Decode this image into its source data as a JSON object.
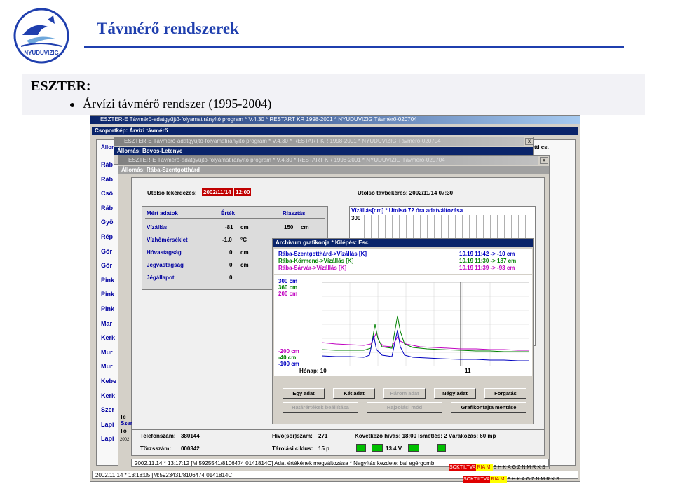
{
  "slide": {
    "title": "Távmérő rendszerek",
    "logo_text": "NYUDUVIZIG",
    "heading": "ESZTER:",
    "bullet": "Árvízi távmérő rendszer (1995-2004)"
  },
  "main_window": {
    "title": "ESZTER-E Távmérő-adatgyűjtő-folyamatirányító program * V.4.30 * RESTART KR 1998-2001 * NYUDUVIZIG Távmérő-020704",
    "group_bar": "Csoportkép: Árvízi távmérő",
    "side_header": "Állom",
    "side_header_right": "tti cs.",
    "sidebar_items": [
      "Ráb",
      "Ráb",
      "Csö",
      "Ráb",
      "Gyö",
      "Rép",
      "Gőr",
      "Gőr",
      "Pink",
      "Pink",
      "Pink",
      "Mar",
      "Kerk",
      "Mur",
      "Mur",
      "Kebe",
      "Kerk",
      "Szer",
      "Lapi",
      "Lapi"
    ],
    "status": "2002.11.14 * 13:18:05 [M:5923431/8106474 0141814C]",
    "flags": [
      "SOKTILTVA",
      "RIA MI",
      "E",
      "H",
      "K",
      "A",
      "G",
      "Z",
      "N",
      "M",
      "R",
      "X",
      "S"
    ]
  },
  "second_window": {
    "title": "ESZTER-E Távmérő-adatgyűjtő-folyamatirányító program * V.4.30 * RESTART KR 1998-2001 * NYUDUVIZIG Távmérő-020704",
    "station_bar": "Állomás: Bovos-Letenye",
    "close": "x"
  },
  "third_window": {
    "title": "ESZTER-E Távmérő-adatgyűjtő-folyamatirányító program * V.4.30 * RESTART KR 1998-2001 * NYUDUVIZIG Távmérő-020704",
    "station_bar": "Állomás: Rába-Szentgotthárd",
    "close": "x",
    "last_query_label": "Utolsó lekérdezés:",
    "last_query_date": "2002/11/14",
    "last_query_time": "12:00",
    "last_remote_label": "Utolsó távbekérés: 2002/11/14  07:30",
    "table_headers": [
      "Mért adatok",
      "Érték",
      "Riasztás"
    ],
    "rows": [
      {
        "name": "Vízállás",
        "value": "-81",
        "unit": "cm",
        "alarm": "150",
        "alarm_unit": "cm"
      },
      {
        "name": "Vízhőmérséklet",
        "value": "-1.0",
        "unit": "°C",
        "alarm": "",
        "alarm_unit": ""
      },
      {
        "name": "Hóvastagság",
        "value": "0",
        "unit": "cm",
        "alarm": "",
        "alarm_unit": ""
      },
      {
        "name": "Jégvastagság",
        "value": "0",
        "unit": "cm",
        "alarm": "",
        "alarm_unit": ""
      },
      {
        "name": "Jégállapot",
        "value": "0",
        "unit": "",
        "alarm": "",
        "alarm_unit": ""
      }
    ],
    "change_title": "Vízállás[cm] * Utolsó 72 óra adatváltozása",
    "change_axis": "300",
    "phone_label": "Telefonszám:",
    "phone_value": "380144",
    "callno_label": "Hívó(sor)szám:",
    "callno_value": "271",
    "next_call": "Következő hívás: 18:00  Ismétlés: 2  Várakozás: 60 mp",
    "id_label": "Törzsszám:",
    "id_value": "000342",
    "cycle_label": "Tárolási ciklus:",
    "cycle_value": "15 p",
    "voltage": "13.4 V",
    "status": "2002.11.14 * 13:17:12 [M:5925541/8106474 0141814C]   Adat értékének megváltozása * Nagyítás kezdete: bal egérgomb",
    "flags": [
      "SOKTILTVA",
      "RIA MI",
      "E",
      "H",
      "K",
      "A",
      "G",
      "Z",
      "N",
      "M",
      "R",
      "X",
      "S"
    ],
    "left_labels": [
      "Szer",
      "Lapi"
    ],
    "tiny_labels": [
      "Te",
      "Tö",
      "2002"
    ]
  },
  "graph_window": {
    "title": "Archívum grafikonja * Kilépés: Esc",
    "legend": [
      {
        "label": "Rába-Szentgotthárd->Vízállás [K]",
        "value": "10.19 11:42 -> -10 cm",
        "color": "#0000c0"
      },
      {
        "label": "Rába-Körmend->Vízállás [K]",
        "value": "10.19 11:30 -> 187 cm",
        "color": "#008000"
      },
      {
        "label": "Rába-Sárvár->Vízállás [K]",
        "value": "10.19 11:39 -> -93 cm",
        "color": "#c000c0"
      }
    ],
    "y_top_labels": [
      "300 cm",
      "360 cm",
      "200 cm"
    ],
    "y_bottom_labels": [
      "-200 cm",
      "-40 cm",
      "-100 cm"
    ],
    "x_label": "Hónap: 10",
    "x_label2": "11",
    "buttons_row1": [
      {
        "label": "Egy adat",
        "disabled": false
      },
      {
        "label": "Két adat",
        "disabled": false
      },
      {
        "label": "Három adat",
        "disabled": true
      },
      {
        "label": "Négy adat",
        "disabled": false
      },
      {
        "label": "Forgatás",
        "disabled": false
      }
    ],
    "buttons_row2": [
      {
        "label": "Határértékek beállítása",
        "disabled": true
      },
      {
        "label": "Rajzolási mód",
        "disabled": true
      },
      {
        "label": "Grafikonfajta mentése",
        "disabled": false
      }
    ]
  }
}
